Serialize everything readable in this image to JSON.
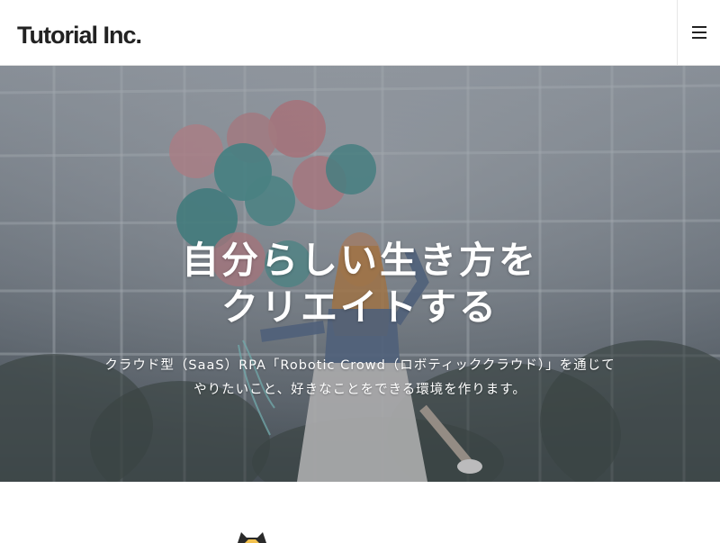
{
  "header": {
    "logo_text": "Tutorial Inc.",
    "menu_icon": "hamburger-menu-icon"
  },
  "hero": {
    "title_line1": "自分らしい生き方を",
    "title_line2": "クリエイトする",
    "subtitle_line1": "クラウド型（SaaS）RPA「Robotic Crowd（ロボティッククラウド）」を通じて",
    "subtitle_line2": "やりたいこと、好きなことをできる環境を作ります。",
    "background_image": "woman-with-balloons-photo"
  },
  "section": {
    "mascot_icon": "cat-mascot-icon"
  },
  "colors": {
    "header_bg": "#ffffff",
    "logo_text": "#222222",
    "hero_overlay": "#6f7881",
    "hero_text": "#ffffff"
  }
}
